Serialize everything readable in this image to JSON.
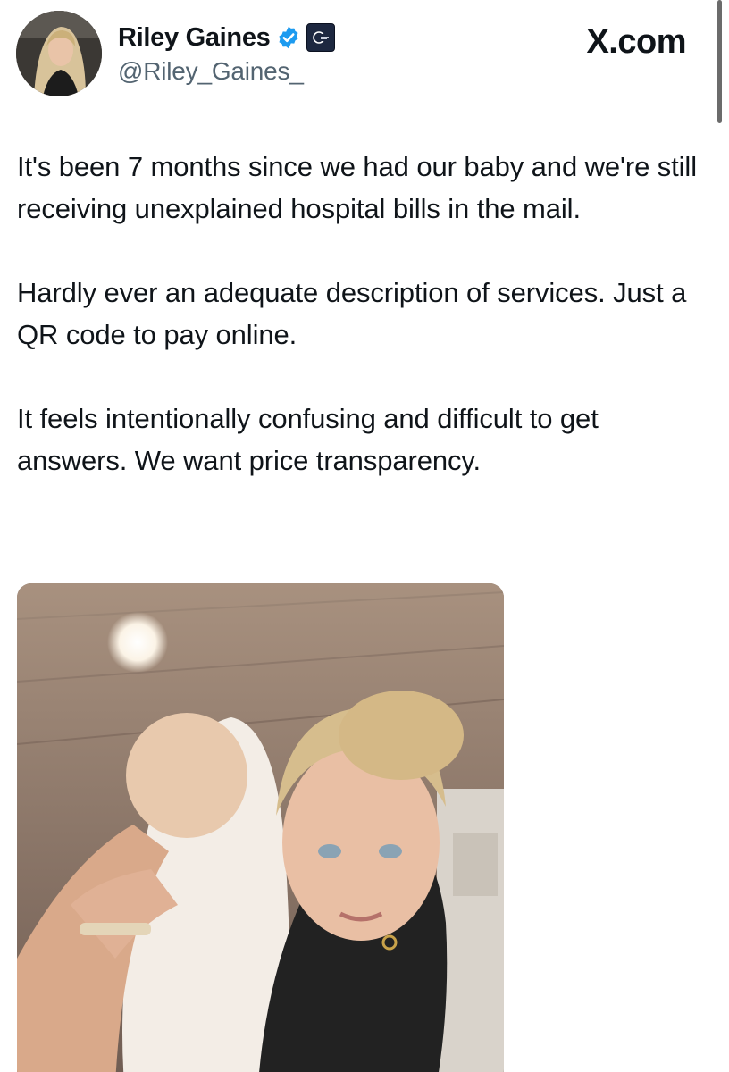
{
  "author": {
    "display_name": "Riley Gaines",
    "handle": "@Riley_Gaines_"
  },
  "source_label": "X.com",
  "tweet": {
    "paragraphs": [
      "It's been 7 months since we had our baby and we're still receiving unexplained hospital bills in the mail.",
      "Hardly ever an adequate description of services. Just a QR code to pay online.",
      "It feels intentionally confusing and difficult to get answers. We want price transparency."
    ]
  },
  "icons": {
    "verified": "verified-badge-icon",
    "affiliate": "affiliate-badge-icon"
  },
  "colors": {
    "verified_blue": "#1d9bf0",
    "text_primary": "#0f1419",
    "text_secondary": "#536471"
  }
}
